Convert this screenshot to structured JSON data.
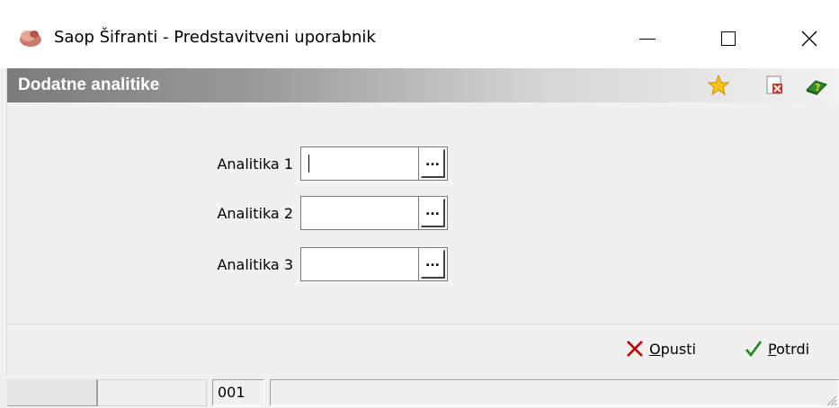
{
  "window": {
    "title": "Saop Šifranti - Predstavitveni uporabnik",
    "app_icon": "app-icon"
  },
  "header": {
    "title": "Dodatne analitike",
    "icons": [
      "star-icon",
      "delete-icon",
      "help-book-icon"
    ]
  },
  "form": {
    "fields": [
      {
        "label": "Analitika 1",
        "value": "",
        "button_label": "..."
      },
      {
        "label": "Analitika 2",
        "value": "",
        "button_label": "..."
      },
      {
        "label": "Analitika 3",
        "value": "",
        "button_label": "..."
      }
    ]
  },
  "actions": {
    "cancel_first": "O",
    "cancel_rest": "pusti",
    "confirm_first": "P",
    "confirm_rest": "otrdi"
  },
  "status": {
    "cell3": "001"
  },
  "colors": {
    "header_text": "#ffffff",
    "cancel_icon": "#c00000",
    "confirm_icon": "#1a8a1a",
    "star": "#f5b800"
  }
}
